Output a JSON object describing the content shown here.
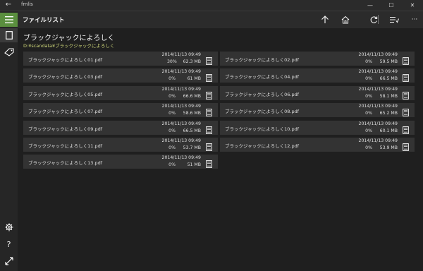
{
  "window": {
    "title": "fmlis",
    "back_glyph": "←",
    "minimize_glyph": "—",
    "maximize_glyph": "☐",
    "close_glyph": "✕"
  },
  "header": {
    "title": "ファイルリスト",
    "icons": [
      "arrow-up-icon",
      "home-icon",
      "refresh-icon",
      "list-settings-icon",
      "more-icon"
    ],
    "more_glyph": "···"
  },
  "sidebar": {
    "top_items": [
      "hamburger-menu-icon",
      "file-icon",
      "tag-icon"
    ],
    "bottom_items": [
      "settings-gear-icon",
      "help-question-icon",
      "expand-arrows-icon"
    ],
    "help_glyph": "?"
  },
  "folder": {
    "title": "ブラックジャックによろしく",
    "path": "D:¥scandata¥ブラックジャックによろしく"
  },
  "files": [
    {
      "name": "ブラックジャックによろしく01.pdf",
      "date": "2014/11/13 09:49",
      "progress": "30%",
      "size": "62.3 MB"
    },
    {
      "name": "ブラックジャックによろしく02.pdf",
      "date": "2014/11/13 09:49",
      "progress": "0%",
      "size": "59.5 MB"
    },
    {
      "name": "ブラックジャックによろしく03.pdf",
      "date": "2014/11/13 09:49",
      "progress": "0%",
      "size": "61 MB"
    },
    {
      "name": "ブラックジャックによろしく04.pdf",
      "date": "2014/11/13 09:49",
      "progress": "0%",
      "size": "66.5 MB"
    },
    {
      "name": "ブラックジャックによろしく05.pdf",
      "date": "2014/11/13 09:49",
      "progress": "0%",
      "size": "66.6 MB"
    },
    {
      "name": "ブラックジャックによろしく06.pdf",
      "date": "2014/11/13 09:49",
      "progress": "0%",
      "size": "58.1 MB"
    },
    {
      "name": "ブラックジャックによろしく07.pdf",
      "date": "2014/11/13 09:49",
      "progress": "0%",
      "size": "58.6 MB"
    },
    {
      "name": "ブラックジャックによろしく08.pdf",
      "date": "2014/11/13 09:49",
      "progress": "0%",
      "size": "65.2 MB"
    },
    {
      "name": "ブラックジャックによろしく09.pdf",
      "date": "2014/11/13 09:49",
      "progress": "0%",
      "size": "66.5 MB"
    },
    {
      "name": "ブラックジャックによろしく10.pdf",
      "date": "2014/11/13 09:49",
      "progress": "0%",
      "size": "60.1 MB"
    },
    {
      "name": "ブラックジャックによろしく11.pdf",
      "date": "2014/11/13 09:49",
      "progress": "0%",
      "size": "53.7 MB"
    },
    {
      "name": "ブラックジャックによろしく12.pdf",
      "date": "2014/11/13 09:49",
      "progress": "0%",
      "size": "53.9 MB"
    },
    {
      "name": "ブラックジャックによろしく13.pdf",
      "date": "2014/11/13 09:49",
      "progress": "0%",
      "size": "51 MB"
    }
  ],
  "colors": {
    "accent": "#5a8f3e",
    "path_text": "#cfd87a",
    "tile_bg": "#333333",
    "app_bg": "#1f1f1f"
  }
}
